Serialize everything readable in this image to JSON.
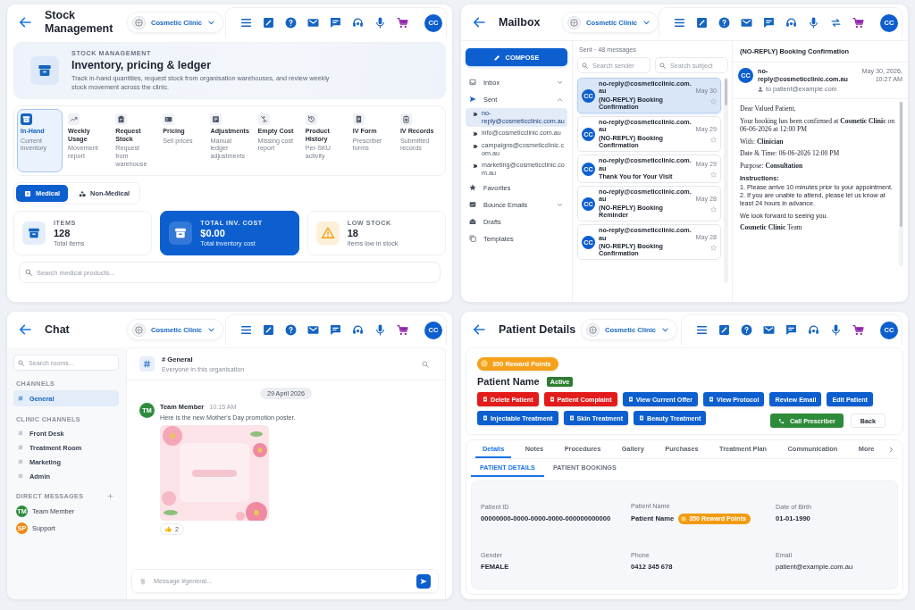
{
  "stock": {
    "header": {
      "title": "Stock Management",
      "clinic": "Cosmetic Clinic",
      "avatar": "CC",
      "toolbar": [
        {
          "kind": "menu"
        },
        {
          "kind": "edit"
        },
        {
          "kind": "help"
        },
        {
          "kind": "mail"
        },
        {
          "kind": "chat"
        },
        {
          "kind": "support"
        },
        {
          "kind": "mic"
        },
        {
          "kind": "cart"
        }
      ]
    },
    "hero": {
      "eyebrow": "STOCK MANAGEMENT",
      "title": "Inventory, pricing & ledger",
      "description": "Track in-hand quantities, request stock from organisation warehouses, and review weekly stock movement across the clinic."
    },
    "nav": [
      {
        "kind": "box",
        "label": "In-Hand",
        "caption": "Current inventory",
        "selected": true
      },
      {
        "kind": "trend",
        "label": "Weekly Usage",
        "caption": "Movement report",
        "selected": false
      },
      {
        "kind": "clipboard",
        "label": "Request Stock",
        "caption": "Request from warehouse",
        "selected": false
      },
      {
        "kind": "card",
        "label": "Pricing",
        "caption": "Sell prices",
        "selected": false
      },
      {
        "kind": "ledger",
        "label": "Adjustments",
        "caption": "Manual ledger adjustments",
        "selected": false
      },
      {
        "kind": "nocost",
        "label": "Empty Cost",
        "caption": "Missing cost report",
        "selected": false
      },
      {
        "kind": "history",
        "label": "Product History",
        "caption": "Per-SKU activity",
        "selected": false
      },
      {
        "kind": "form",
        "label": "IV Form",
        "caption": "Prescriber forms",
        "selected": false
      },
      {
        "kind": "records",
        "label": "IV Records",
        "caption": "Submitted records",
        "selected": false
      }
    ],
    "categories": [
      {
        "kind": "medical",
        "label": "Medical",
        "selected": true
      },
      {
        "kind": "shapes",
        "label": "Non-Medical",
        "selected": false
      }
    ],
    "stats": [
      {
        "kind": "neutral",
        "label": "ITEMS",
        "value": "128",
        "caption": "Total items"
      },
      {
        "kind": "primary",
        "label": "TOTAL INV. COST",
        "value": "$0.00",
        "caption": "Total inventory cost"
      },
      {
        "kind": "warning",
        "label": "LOW STOCK",
        "value": "18",
        "caption": "Items low in stock"
      }
    ],
    "search": {
      "placeholder": "Search medical products..."
    }
  },
  "mailbox": {
    "header": {
      "title": "Mailbox",
      "clinic": "Cosmetic Clinic",
      "avatar": "CC",
      "toolbar": [
        {
          "kind": "menu"
        },
        {
          "kind": "edit"
        },
        {
          "kind": "help"
        },
        {
          "kind": "mail"
        },
        {
          "kind": "chat"
        },
        {
          "kind": "support"
        },
        {
          "kind": "mic"
        },
        {
          "kind": "swap"
        },
        {
          "kind": "cart"
        }
      ]
    },
    "compose": "COMPOSE",
    "folders": [
      {
        "kind": "inbox",
        "label": "Inbox",
        "expanded": false
      },
      {
        "kind": "send",
        "label": "Sent",
        "expanded": true,
        "children": [
          {
            "label": "no-reply@cosmeticclinic.com.au",
            "selected": true
          },
          {
            "label": "info@cosmeticclinic.com.au",
            "selected": false
          },
          {
            "label": "campaigns@cosmeticclinic.com.au",
            "selected": false
          },
          {
            "label": "marketing@cosmeticclinic.com.au",
            "selected": false
          }
        ]
      },
      {
        "kind": "star",
        "label": "Favorites"
      },
      {
        "kind": "bounce",
        "label": "Bounce Emails",
        "expanded": false
      },
      {
        "kind": "drafts",
        "label": "Drafts"
      },
      {
        "kind": "templates",
        "label": "Templates"
      }
    ],
    "list_title": "Sent · 48 messages",
    "search_sender": {
      "placeholder": "Search sender"
    },
    "search_subject": {
      "placeholder": "Search subject"
    },
    "messages": [
      {
        "avatar": "CC",
        "from": "no-reply@cosmeticclinic.com.au",
        "subject": "(NO-REPLY) Booking Confirmation",
        "date": "May 30",
        "selected": true
      },
      {
        "avatar": "CC",
        "from": "no-reply@cosmeticclinic.com.au",
        "subject": "(NO-REPLY) Booking Confirmation",
        "date": "May 29",
        "selected": false
      },
      {
        "avatar": "CC",
        "from": "no-reply@cosmeticclinic.com.au",
        "subject": "Thank You for Your Visit",
        "date": "May 29",
        "selected": false
      },
      {
        "avatar": "CC",
        "from": "no-reply@cosmeticclinic.com.au",
        "subject": "(NO-REPLY) Booking Reminder",
        "date": "May 28",
        "selected": false
      },
      {
        "avatar": "CC",
        "from": "no-reply@cosmeticclinic.com.au",
        "subject": "(NO-REPLY) Booking Confirmation",
        "date": "May 28",
        "selected": false
      }
    ],
    "reading": {
      "subject": "(NO-REPLY) Booking Confirmation",
      "avatar": "CC",
      "from": "no-reply@cosmeticclinic.com.au",
      "to": "to patient@example.com",
      "date": "May 30, 2026, 10:27 AM",
      "body": [
        {
          "kind": "letter",
          "text": "Dear Valued Patient,"
        },
        {
          "kind": "letter",
          "text": "Your booking has been confirmed at **Cosmetic Clinic** on 06-06-2026 at 12:00 PM"
        },
        {
          "kind": "letter",
          "text": "With: **Clinician**"
        },
        {
          "kind": "letter",
          "text": "Date & Time: 06-06-2026 12:00 PM"
        },
        {
          "kind": "letter",
          "text": "Purpose: **Consultation**"
        },
        {
          "kind": "heading",
          "text": "Instructions:"
        },
        {
          "kind": "list",
          "text": "1. Please arrive 10 minutes prior to your appointment."
        },
        {
          "kind": "list",
          "text": "2. If you are unable to attend, please let us know at least 24 hours in advance."
        },
        {
          "kind": "note",
          "text": "We look forward to seeing you."
        },
        {
          "kind": "letter",
          "text": "**Cosmetic Clinic** Team"
        }
      ]
    }
  },
  "chat": {
    "header": {
      "title": "Chat",
      "clinic": "Cosmetic Clinic",
      "avatar": "CC",
      "toolbar": [
        {
          "kind": "menu"
        },
        {
          "kind": "edit"
        },
        {
          "kind": "help"
        },
        {
          "kind": "mail"
        },
        {
          "kind": "chat"
        },
        {
          "kind": "support"
        },
        {
          "kind": "mic"
        },
        {
          "kind": "cart"
        }
      ]
    },
    "search": {
      "placeholder": "Search rooms..."
    },
    "sections": [
      {
        "title": "CHANNELS",
        "rooms": [
          {
            "name": "General",
            "selected": true
          }
        ]
      },
      {
        "title": "CLINIC CHANNELS",
        "rooms": [
          {
            "name": "Front Desk",
            "selected": false
          },
          {
            "name": "Treatment Room",
            "selected": false
          },
          {
            "name": "Marketing",
            "selected": false
          },
          {
            "name": "Admin",
            "selected": false
          }
        ]
      }
    ],
    "direct_messages": {
      "title": "DIRECT MESSAGES",
      "people": [
        {
          "initials": "TM",
          "name": "Team Member",
          "color": "#2e8b3e"
        },
        {
          "initials": "SP",
          "name": "Support",
          "color": "#ef8a12"
        }
      ]
    },
    "channel": {
      "name": "# General",
      "description": "Everyone in this organisation"
    },
    "date": "29 April 2026",
    "message": {
      "initials": "TM",
      "color": "#2e8b3e",
      "author": "Team Member",
      "time": "10:15 AM",
      "text": "Here is the new Mother's Day promotion poster.",
      "reaction": {
        "count": "2"
      }
    },
    "composer": {
      "placeholder": "Message #general..."
    }
  },
  "patient": {
    "header": {
      "title": "Patient Details",
      "clinic": "Cosmetic Clinic",
      "avatar": "CC",
      "toolbar": [
        {
          "kind": "menu"
        },
        {
          "kind": "edit"
        },
        {
          "kind": "help"
        },
        {
          "kind": "mail"
        },
        {
          "kind": "chat"
        },
        {
          "kind": "support"
        },
        {
          "kind": "mic"
        },
        {
          "kind": "cart"
        }
      ]
    },
    "reward": "350 Reward Points",
    "name": "Patient Name",
    "status": "Active",
    "actions": [
      {
        "kind": "danger",
        "label": "Delete Patient",
        "icon": true
      },
      {
        "kind": "danger",
        "label": "Patient Complaint",
        "icon": true
      },
      {
        "kind": "primary",
        "label": "View Current Offer",
        "icon": true
      },
      {
        "kind": "primary",
        "label": "View Protocol",
        "icon": true
      },
      {
        "kind": "primary",
        "label": "Review Email",
        "icon": false
      },
      {
        "kind": "primary",
        "label": "Edit Patient",
        "icon": false
      },
      {
        "kind": "primary",
        "label": "Injectable Treatment",
        "icon": true
      },
      {
        "kind": "primary",
        "label": "Skin Treatment",
        "icon": true
      },
      {
        "kind": "primary",
        "label": "Beauty Treatment",
        "icon": true
      }
    ],
    "call_button": "Call Prescriber",
    "back_button": "Back",
    "tabs": [
      {
        "label": "Details",
        "selected": true
      },
      {
        "label": "Notes",
        "selected": false
      },
      {
        "label": "Procedures",
        "selected": false
      },
      {
        "label": "Gallery",
        "selected": false
      },
      {
        "label": "Purchases",
        "selected": false
      },
      {
        "label": "Treatment Plan",
        "selected": false
      },
      {
        "label": "Communication",
        "selected": false
      },
      {
        "label": "More",
        "selected": false
      }
    ],
    "subtabs": [
      {
        "label": "PATIENT DETAILS",
        "selected": true
      },
      {
        "label": "PATIENT BOOKINGS",
        "selected": false
      }
    ],
    "fields": [
      {
        "label": "Patient ID",
        "value": "00000000-0000-0000-0000-000000000000",
        "kind": "strong"
      },
      {
        "label": "Patient Name",
        "value": "Patient Name",
        "badge": "350 Reward Points",
        "kind": "strong"
      },
      {
        "label": "Date of Birth",
        "value": "01-01-1990",
        "kind": "strong"
      },
      {
        "label": "Gender",
        "value": "FEMALE",
        "kind": "strong"
      },
      {
        "label": "Phone",
        "value": "0412 345 678",
        "kind": "strong"
      },
      {
        "label": "Email",
        "value": "patient@example.com.au",
        "kind": "plain"
      }
    ]
  }
}
